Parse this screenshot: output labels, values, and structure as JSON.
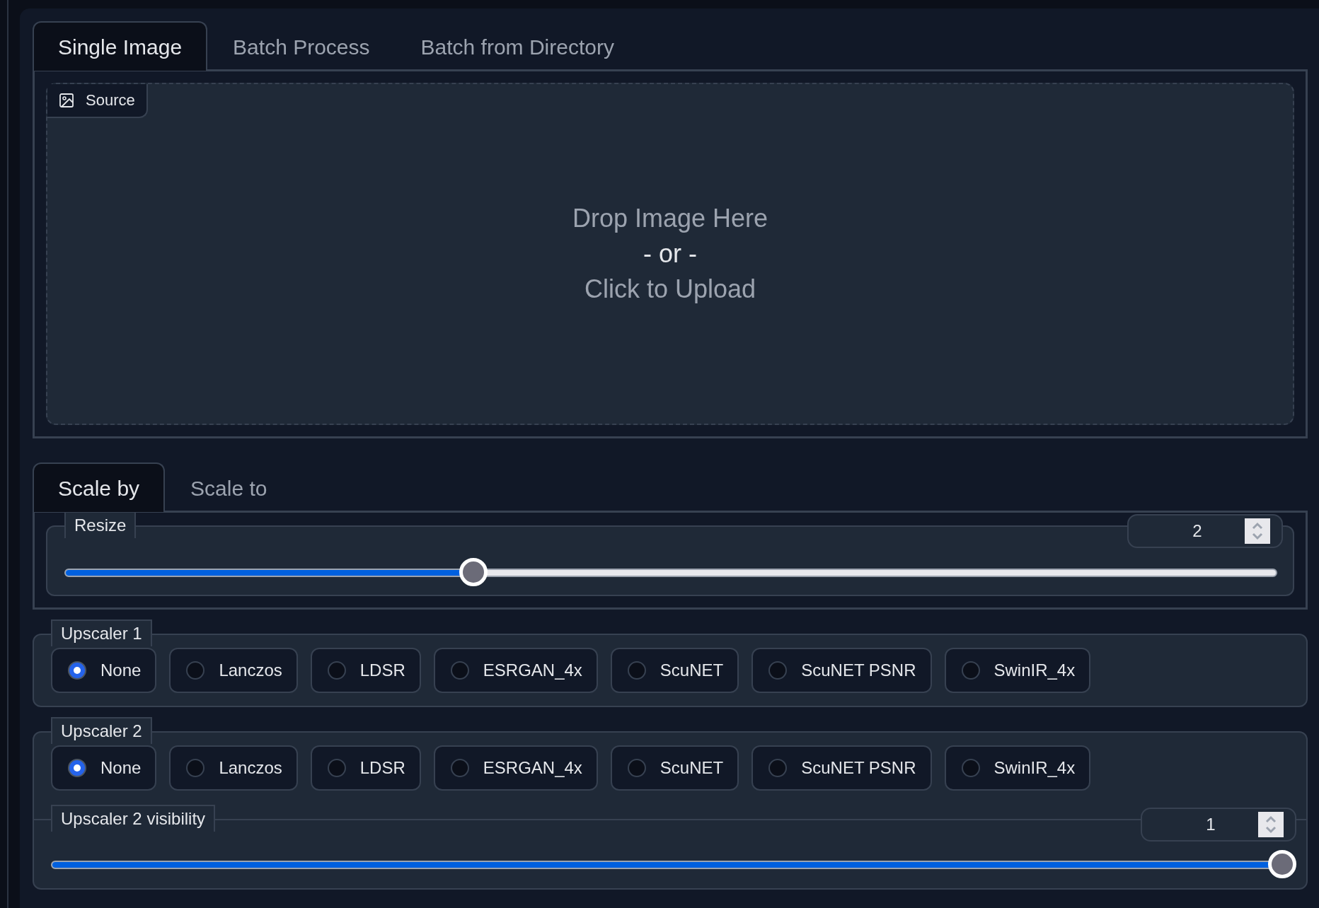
{
  "source_tabs": [
    {
      "label": "Single Image",
      "selected": true
    },
    {
      "label": "Batch Process",
      "selected": false
    },
    {
      "label": "Batch from Directory",
      "selected": false
    }
  ],
  "source": {
    "label": "Source",
    "drop_text": [
      "Drop Image Here",
      "- or -",
      "Click to Upload"
    ]
  },
  "scale_tabs": [
    {
      "label": "Scale by",
      "selected": true
    },
    {
      "label": "Scale to",
      "selected": false
    }
  ],
  "resize": {
    "label": "Resize",
    "value": "2",
    "level": 0.337
  },
  "upscaler_1": {
    "label": "Upscaler 1",
    "options": [
      {
        "label": "None",
        "selected": true
      },
      {
        "label": "Lanczos",
        "selected": false
      },
      {
        "label": "LDSR",
        "selected": false
      },
      {
        "label": "ESRGAN_4x",
        "selected": false
      },
      {
        "label": "ScuNET",
        "selected": false
      },
      {
        "label": "ScuNET PSNR",
        "selected": false
      },
      {
        "label": "SwinIR_4x",
        "selected": false
      }
    ]
  },
  "upscaler_2": {
    "label": "Upscaler 2",
    "options": [
      {
        "label": "None",
        "selected": true
      },
      {
        "label": "Lanczos",
        "selected": false
      },
      {
        "label": "LDSR",
        "selected": false
      },
      {
        "label": "ESRGAN_4x",
        "selected": false
      },
      {
        "label": "ScuNET",
        "selected": false
      },
      {
        "label": "ScuNET PSNR",
        "selected": false
      },
      {
        "label": "SwinIR_4x",
        "selected": false
      }
    ]
  },
  "upscaler_2_visibility": {
    "label": "Upscaler 2 visibility",
    "value": "1",
    "level": 1
  }
}
